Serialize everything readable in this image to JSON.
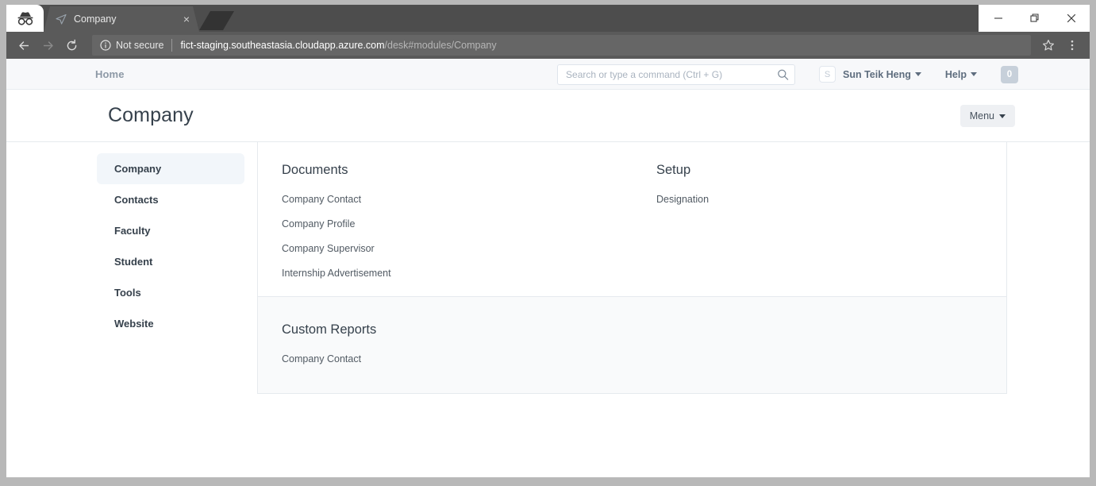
{
  "browser": {
    "incognito_icon": "incognito-icon",
    "tab": {
      "favicon": "paper-plane-icon",
      "title": "Company",
      "close_label": "×"
    },
    "window_controls": {
      "minimize": "minimize-icon",
      "restore": "restore-icon",
      "close": "close-icon"
    },
    "toolbar": {
      "back": "back-arrow-icon",
      "forward": "forward-arrow-icon",
      "reload": "reload-icon",
      "security_label": "Not secure",
      "url_domain": "fict-staging.southeastasia.cloudapp.azure.com",
      "url_path": "/desk#modules/Company",
      "bookmark": "star-icon",
      "menu": "three-dot-menu-icon"
    }
  },
  "navbar": {
    "home_label": "Home",
    "search": {
      "placeholder": "Search or type a command (Ctrl + G)",
      "value": ""
    },
    "avatar_initial": "S",
    "user_label": "Sun Teik Heng",
    "help_label": "Help",
    "badge_count": "0"
  },
  "page_head": {
    "title": "Company",
    "menu_label": "Menu"
  },
  "sidebar": {
    "items": [
      {
        "label": "Company",
        "active": true
      },
      {
        "label": "Contacts",
        "active": false
      },
      {
        "label": "Faculty",
        "active": false
      },
      {
        "label": "Student",
        "active": false
      },
      {
        "label": "Tools",
        "active": false
      },
      {
        "label": "Website",
        "active": false
      }
    ]
  },
  "main": {
    "sections": [
      {
        "shaded": false,
        "columns": [
          {
            "heading": "Documents",
            "links": [
              "Company Contact",
              "Company Profile",
              "Company Supervisor",
              "Internship Advertisement"
            ]
          },
          {
            "heading": "Setup",
            "links": [
              "Designation"
            ]
          }
        ]
      },
      {
        "shaded": true,
        "columns": [
          {
            "heading": "Custom Reports",
            "links": [
              "Company Contact"
            ]
          }
        ]
      }
    ]
  },
  "colors": {
    "accent_text": "#36414c",
    "muted_text": "#8d99a6",
    "link_text": "#515a63",
    "active_bg": "#f2f6fa",
    "shaded_bg": "#f9fafb",
    "border": "#e6eaee",
    "badge_bg": "#c7d0da"
  }
}
